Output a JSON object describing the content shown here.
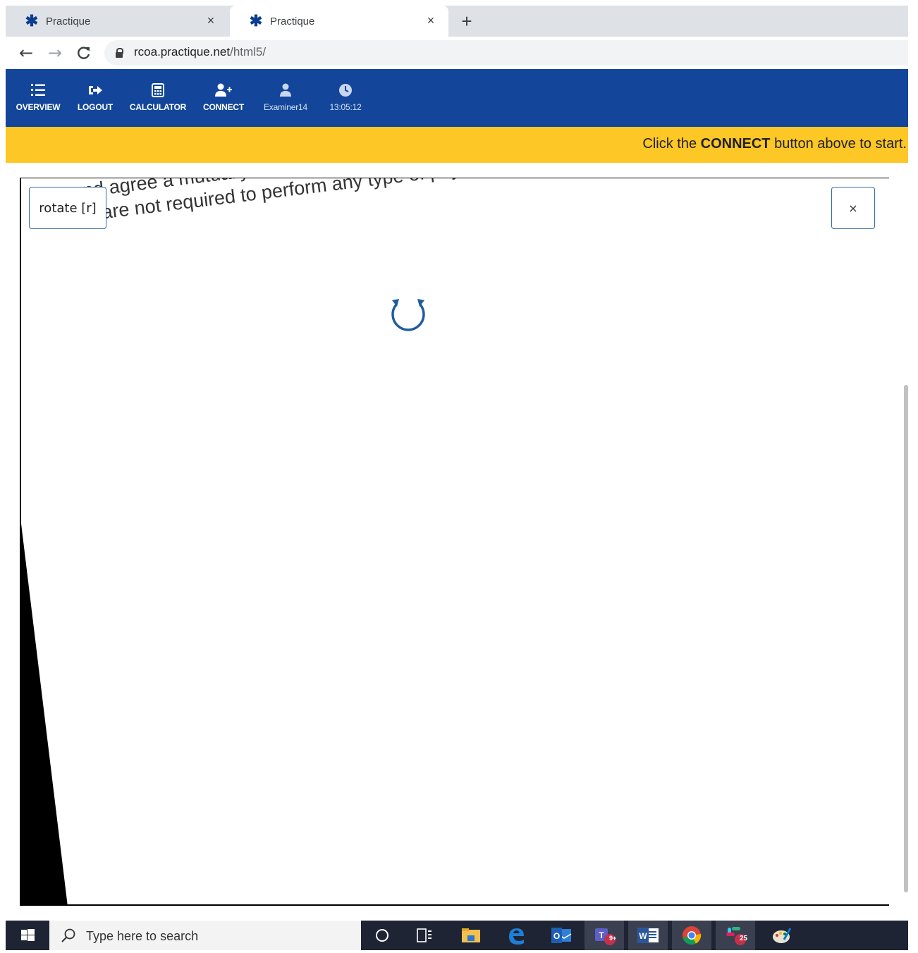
{
  "browser": {
    "tabs": [
      {
        "title": "Practique",
        "active": false
      },
      {
        "title": "Practique",
        "active": true
      }
    ],
    "new_tab_label": "+",
    "close_glyph": "×",
    "url_host": "rcoa.practique.net",
    "url_path": "/html5/"
  },
  "app_nav": {
    "items": [
      {
        "label": "OVERVIEW",
        "icon": "list-icon"
      },
      {
        "label": "LOGOUT",
        "icon": "logout-icon"
      },
      {
        "label": "CALCULATOR",
        "icon": "calculator-icon"
      },
      {
        "label": "CONNECT",
        "icon": "user-plus-icon"
      },
      {
        "label": "Examiner14",
        "icon": "user-icon"
      },
      {
        "label": "13:05:12",
        "icon": "clock-icon"
      }
    ],
    "color": "#13469a"
  },
  "banner": {
    "prefix": "Click the ",
    "emphasis": "CONNECT",
    "suffix": " button above to start.",
    "color": "#fdc725"
  },
  "viewer": {
    "line1": ", and agree a mutually agree",
    "line2": "You are not required to perform any type of physical examination of the p",
    "rotate_label": "rotate [r]",
    "close_label": "×"
  },
  "taskbar": {
    "search_placeholder": "Type here to search",
    "apps": [
      "cortana-icon",
      "task-view-icon",
      "file-explorer-icon",
      "edge-icon",
      "outlook-icon",
      "teams-icon",
      "word-icon",
      "chrome-icon",
      "slack-icon",
      "paint-icon"
    ],
    "teams_badge": "9+",
    "slack_badge": "25"
  }
}
